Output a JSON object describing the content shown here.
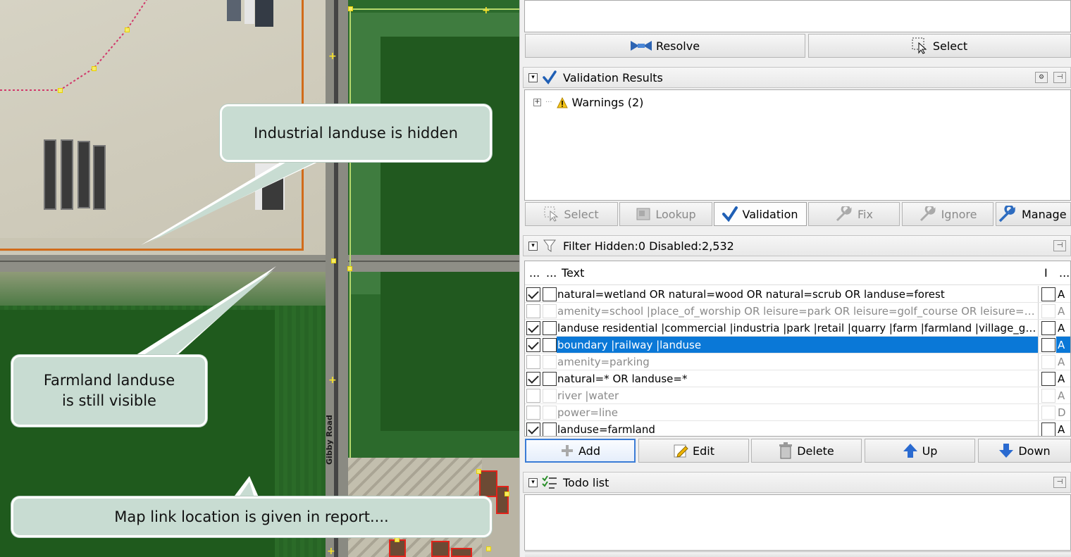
{
  "map": {
    "road_label": "Gibby Road",
    "callouts": [
      {
        "id": "industrial",
        "text": "Industrial landuse is hidden"
      },
      {
        "id": "farmland",
        "text": "Farmland landuse\nis still visible"
      },
      {
        "id": "maplink",
        "text": "Map link location is given in report...."
      }
    ]
  },
  "panel": {
    "top_buttons": {
      "resolve": "Resolve",
      "select": "Select"
    },
    "validation": {
      "title": "Validation Results",
      "tree_item": "Warnings (2)",
      "buttons": {
        "select": "Select",
        "lookup": "Lookup",
        "validation": "Validation",
        "fix": "Fix",
        "ignore": "Ignore",
        "manage": "Manage Ig"
      }
    },
    "filter": {
      "title": "Filter Hidden:0 Disabled:2,532",
      "columns": {
        "c1": "...",
        "c2": "...",
        "text": "Text",
        "i": "I",
        "last": "..."
      },
      "rows": [
        {
          "enabled": true,
          "hidden": false,
          "text": "natural=wetland OR natural=wood OR natural=scrub OR landuse=forest",
          "inverted": false,
          "mode": "A",
          "selected": false
        },
        {
          "enabled": false,
          "hidden": false,
          "text": "amenity=school |place_of_worship OR leisure=park OR leisure=golf_course OR leisure=co...",
          "inverted": false,
          "mode": "A",
          "selected": false
        },
        {
          "enabled": true,
          "hidden": false,
          "text": "landuse residential |commercial |industria |park |retail |quarry |farm |farmland |village_gree...",
          "inverted": false,
          "mode": "A",
          "selected": false
        },
        {
          "enabled": true,
          "hidden": false,
          "text": "boundary |railway |landuse",
          "inverted": false,
          "mode": "A",
          "selected": true
        },
        {
          "enabled": false,
          "hidden": false,
          "text": "amenity=parking",
          "inverted": false,
          "mode": "A",
          "selected": false
        },
        {
          "enabled": true,
          "hidden": false,
          "text": "natural=* OR landuse=*",
          "inverted": false,
          "mode": "A",
          "selected": false
        },
        {
          "enabled": false,
          "hidden": false,
          "text": "river |water",
          "inverted": false,
          "mode": "A",
          "selected": false
        },
        {
          "enabled": false,
          "hidden": false,
          "text": "power=line",
          "inverted": false,
          "mode": "D",
          "selected": false
        },
        {
          "enabled": true,
          "hidden": false,
          "text": "landuse=farmland",
          "inverted": false,
          "mode": "A",
          "selected": false
        }
      ],
      "buttons": {
        "add": "Add",
        "edit": "Edit",
        "delete": "Delete",
        "up": "Up",
        "down": "Down"
      }
    },
    "todo": {
      "title": "Todo list"
    }
  },
  "colors": {
    "selection": "#0a78d7",
    "callout_bg": "#c8dcd2",
    "industrial_outline": "#d16b1a",
    "validation_check": "#1f5fb5"
  }
}
